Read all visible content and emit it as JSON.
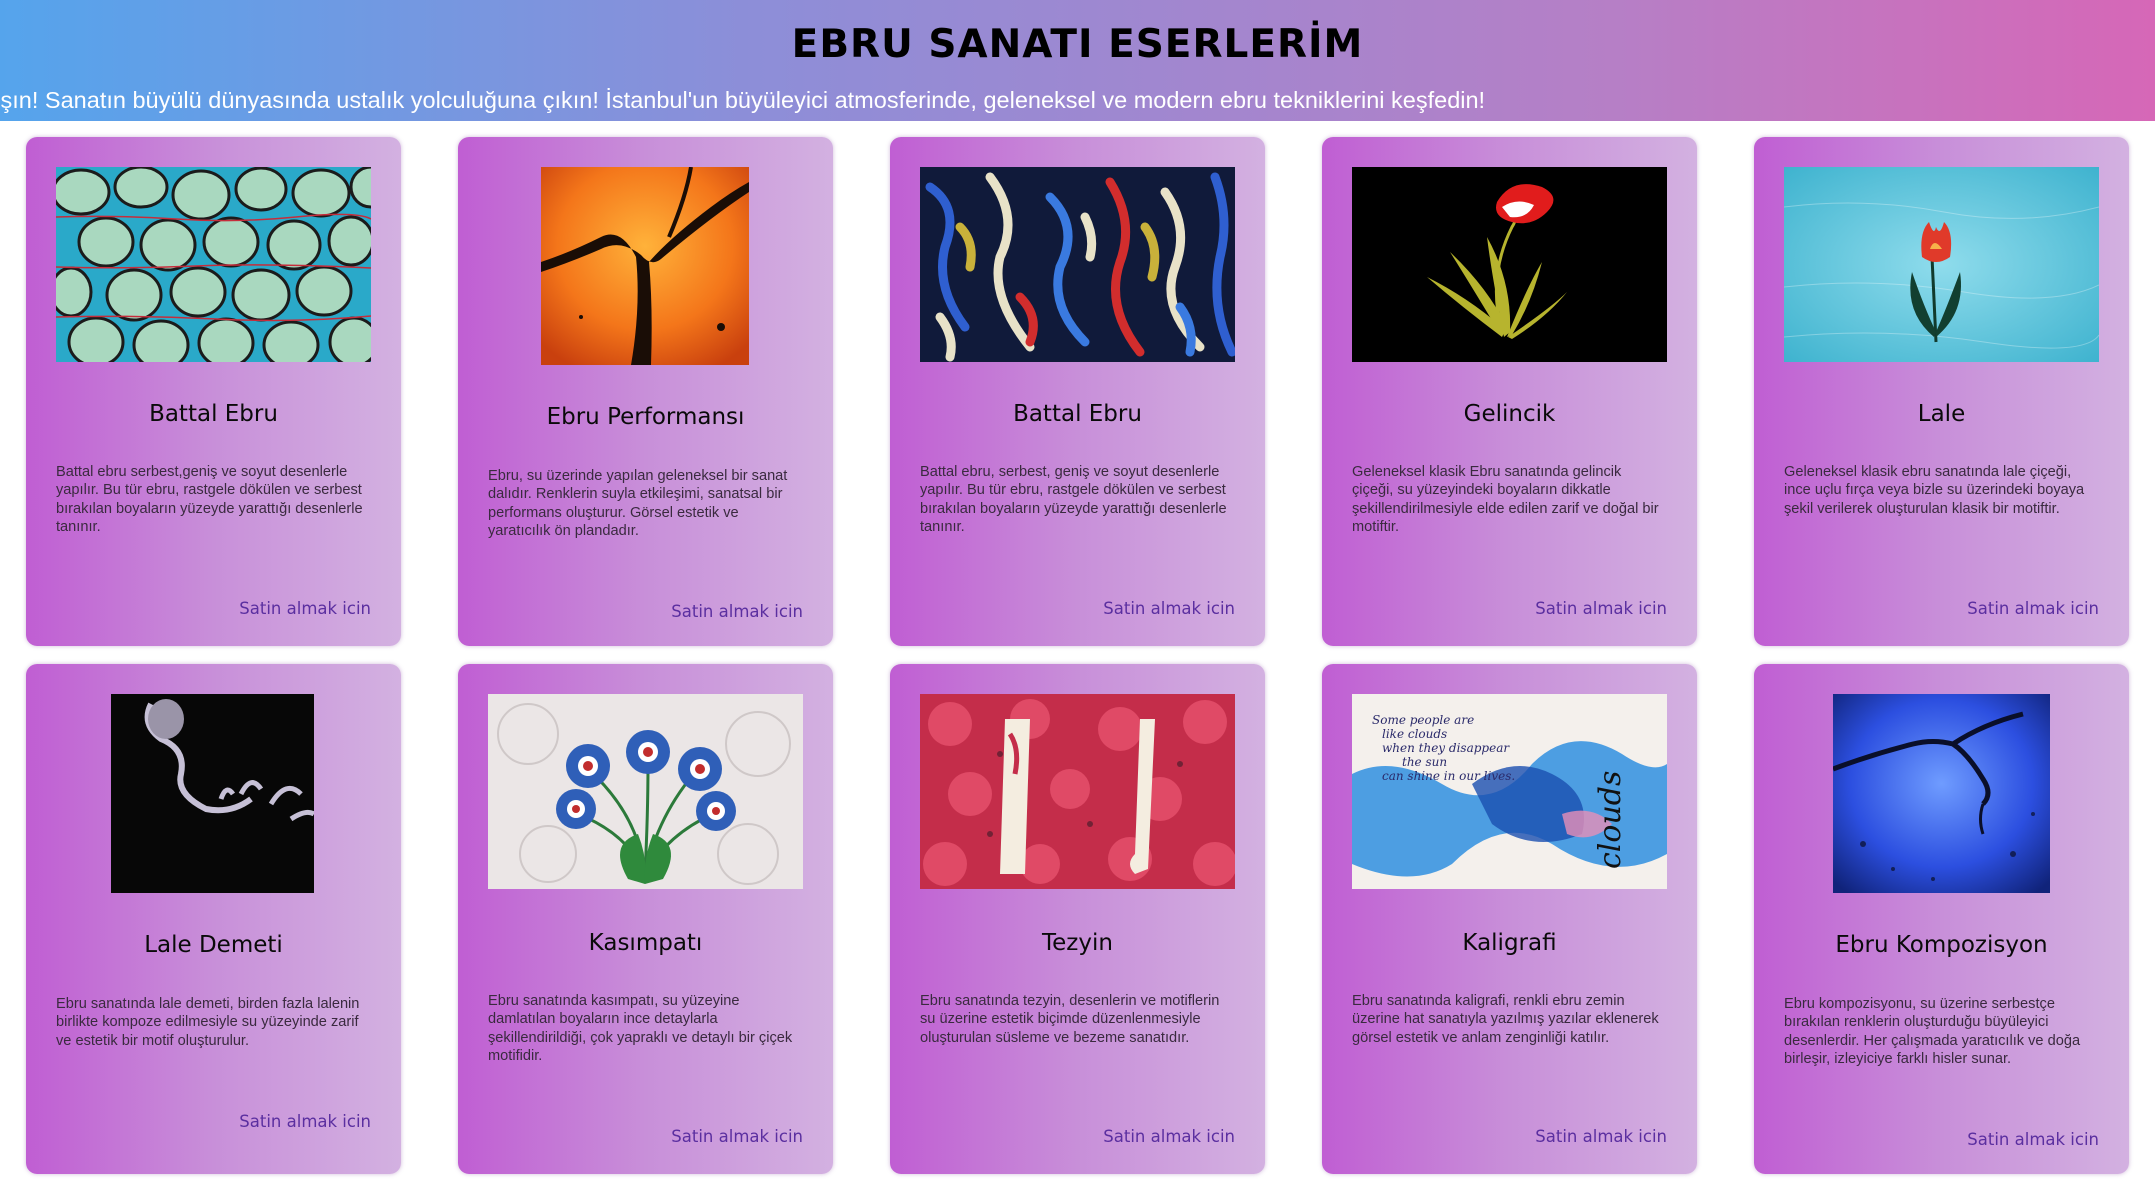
{
  "header": {
    "title": "EBRU SANATI ESERLERİM",
    "marquee": "ışın! Sanatın büyülü dünyasında ustalık yolculuğuna çıkın! İstanbul'un büyüleyici atmosferinde, geleneksel ve modern ebru tekniklerini keşfedin!"
  },
  "cards": [
    {
      "title": "Battal Ebru",
      "description": "Battal ebru serbest,geniş ve soyut desenlerle yapılır. Bu tür ebru, rastgele dökülen ve serbest bırakılan boyaların yüzeyde yarattığı desenlerle tanınır.",
      "link": "Satin almak icin",
      "image": "battal-ebru-green-image"
    },
    {
      "title": "Ebru Performansı",
      "description": "Ebru, su üzerinde yapılan geleneksel bir sanat dalıdır. Renklerin suyla etkileşimi, sanatsal bir performans oluşturur. Görsel estetik ve yaratıcılık ön plandadır.",
      "link": "Satin almak icin",
      "image": "ebru-performance-orange-image"
    },
    {
      "title": "Battal Ebru",
      "description": "Battal ebru, serbest, geniş ve soyut desenlerle yapılır. Bu tür ebru, rastgele dökülen ve serbest bırakılan boyaların yüzeyde yarattığı desenlerle tanınır.",
      "link": "Satin almak icin",
      "image": "battal-ebru-blue-image"
    },
    {
      "title": "Gelincik",
      "description": "Geleneksel klasik Ebru sanatında gelincik çiçeği, su yüzeyindeki boyaların dikkatle şekillendirilmesiyle elde edilen zarif ve doğal bir motiftir.",
      "link": "Satin almak icin",
      "image": "gelincik-flower-image"
    },
    {
      "title": "Lale",
      "description": "Geleneksel klasik ebru sanatında lale çiçeği, ince uçlu fırça veya bizle su üzerindeki boyaya şekil verilerek oluşturulan klasik bir motiftir.",
      "link": "Satin almak icin",
      "image": "lale-tulip-image"
    },
    {
      "title": "Lale Demeti",
      "description": "Ebru sanatında lale demeti, birden fazla lalenin birlikte kompoze edilmesiyle su yüzeyinde zarif ve estetik bir motif oluşturulur.",
      "link": "Satin almak icin",
      "image": "lale-demeti-image"
    },
    {
      "title": "Kasımpatı",
      "description": "Ebru sanatında kasımpatı, su yüzeyine damlatılan boyaların ince detaylarla şekillendirildiği, çok yapraklı ve detaylı bir çiçek motifidir.",
      "link": "Satin almak icin",
      "image": "kasimpati-flower-image"
    },
    {
      "title": "Tezyin",
      "description": "Ebru sanatında tezyin, desenlerin ve motiflerin su üzerine estetik biçimde düzenlenmesiyle oluşturulan süsleme ve bezeme sanatıdır.",
      "link": "Satin almak icin",
      "image": "tezyin-red-image"
    },
    {
      "title": "Kaligrafi",
      "description": "Ebru sanatında kaligrafi, renkli ebru zemin üzerine hat sanatıyla yazılmış yazılar eklenerek görsel estetik ve anlam zenginliği katılır.",
      "link": "Satin almak icin",
      "image": "kaligrafi-image",
      "image_text": [
        "Some people are",
        "like clouds",
        "when they disappear",
        "the sun",
        "can shine in our lives."
      ],
      "image_word": "clouds"
    },
    {
      "title": "Ebru Kompozisyon",
      "description": "Ebru kompozisyonu, su üzerine serbestçe bırakılan renklerin oluşturduğu büyüleyici desenlerdir. Her çalışmada yaratıcılık ve doğa birleşir, izleyiciye farklı hisler sunar.",
      "link": "Satin almak icin",
      "image": "ebru-kompozisyon-blue-image"
    }
  ]
}
